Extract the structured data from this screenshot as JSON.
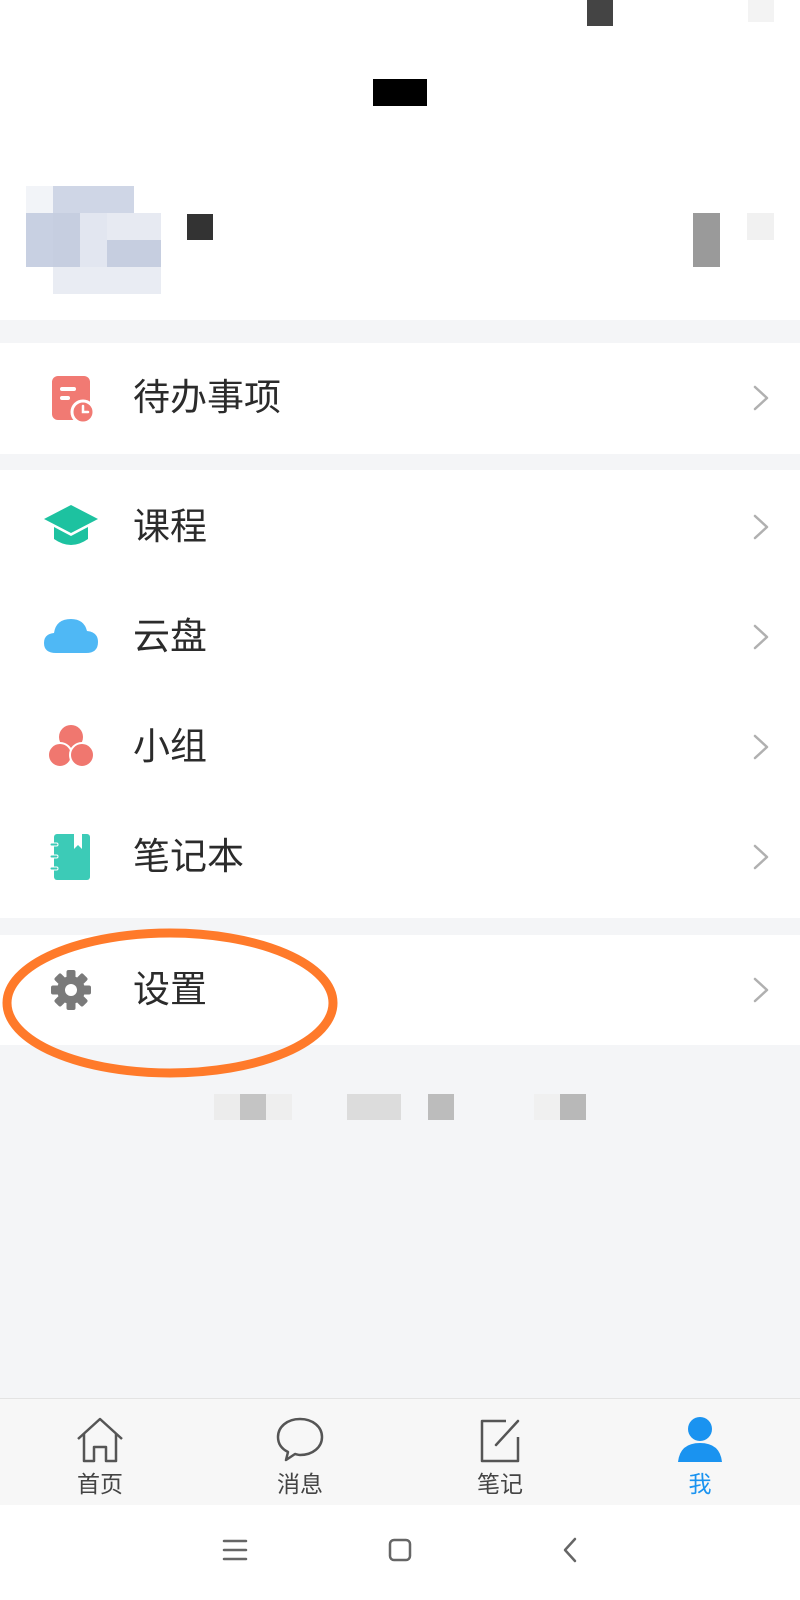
{
  "menu": {
    "todo": {
      "label": "待办事项",
      "icon": "todo-icon",
      "color": "#f17a73"
    },
    "items": [
      {
        "label": "课程",
        "icon": "graduation-cap-icon",
        "color": "#1dc2a0"
      },
      {
        "label": "云盘",
        "icon": "cloud-icon",
        "color": "#4fb8f5"
      },
      {
        "label": "小组",
        "icon": "group-icon",
        "color": "#f0776f"
      },
      {
        "label": "笔记本",
        "icon": "notebook-icon",
        "color": "#3ccbb7"
      }
    ],
    "settings": {
      "label": "设置",
      "icon": "gear-icon",
      "color": "#7a7a7a"
    }
  },
  "bottom_nav": {
    "items": [
      {
        "label": "首页",
        "icon": "home-icon",
        "active": false
      },
      {
        "label": "消息",
        "icon": "message-icon",
        "active": false
      },
      {
        "label": "笔记",
        "icon": "note-edit-icon",
        "active": false
      },
      {
        "label": "我",
        "icon": "user-icon",
        "active": true
      }
    ],
    "active_color": "#1a93f0"
  },
  "system_nav": {
    "buttons": [
      "menu-icon",
      "home-square-icon",
      "back-icon"
    ]
  },
  "annotation": {
    "color": "#ff7a2a"
  }
}
